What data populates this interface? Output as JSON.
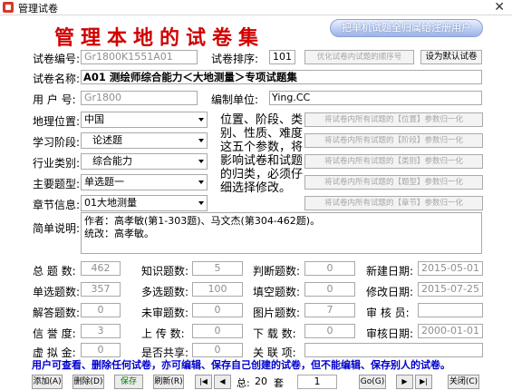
{
  "window": {
    "title": "管理试卷",
    "close_glyph": "✕"
  },
  "heading": "管理本地的试卷集",
  "assign_button": "把单机试题全归属给注册用户",
  "paper_no": {
    "label": "试卷编号:",
    "value": "Gr1800K1551A01"
  },
  "order": {
    "label": "试卷排序:",
    "value": "101"
  },
  "optimize_button": "优化试卷内试题的顺序号",
  "default_button": "设为默认试卷",
  "paper_name": {
    "label": "试卷名称:",
    "value": "A01 测绘师综合能力＜大地测量＞专项试题集"
  },
  "user_no": {
    "label": "用 户 号:",
    "value": "Gr1800"
  },
  "unit": {
    "label": "编制单位:",
    "value": "Ying.CC"
  },
  "location": {
    "label": "地理位置:",
    "value": "中国"
  },
  "stage": {
    "label": "学习阶段:",
    "value": "论述题"
  },
  "industry": {
    "label": "行业类别:",
    "value": "综合能力"
  },
  "main_type": {
    "label": "主要题型:",
    "value": "单选题一"
  },
  "chapter": {
    "label": "章节信息:",
    "value": "01大地测量"
  },
  "note": "位置、阶段、类别、性质、难度这五个参数，将影响试卷和试题的归类，必须仔细选择修改。",
  "normalize_buttons": [
    "将试卷内所有试题的【位置】参数归一化",
    "将试卷内所有试题的【阶段】参数归一化",
    "将试卷内所有试题的【类别】参数归一化",
    "将试卷内所有试题的【题型】参数归一化",
    "将试卷内所有试题的【章节】参数归一化"
  ],
  "desc": {
    "label": "简单说明:",
    "line1": "作者：高孝敏(第1-303题)、马文杰(第304-462题)。",
    "line2": "统改：高孝敏。"
  },
  "stats": {
    "total": {
      "label": "总 题 数:",
      "value": "462"
    },
    "knowledge": {
      "label": "知识题数:",
      "value": "5"
    },
    "judge": {
      "label": "判断题数:",
      "value": "0"
    },
    "created": {
      "label": "新建日期:",
      "value": "2015-05-01"
    },
    "single": {
      "label": "单选题数:",
      "value": "357"
    },
    "multi": {
      "label": "多选题数:",
      "value": "100"
    },
    "fill": {
      "label": "填空题数:",
      "value": "0"
    },
    "modified": {
      "label": "修改日期:",
      "value": "2015-07-25"
    },
    "answer": {
      "label": "解答题数:",
      "value": "0"
    },
    "unaudited": {
      "label": "未审题数:",
      "value": "0"
    },
    "image": {
      "label": "图片题数:",
      "value": "7"
    },
    "auditor": {
      "label": "审 核 员:",
      "value": ""
    },
    "credit": {
      "label": "信 誉 度:",
      "value": "3"
    },
    "upload": {
      "label": "上 传 数:",
      "value": "0"
    },
    "download": {
      "label": "下 载 数:",
      "value": "0"
    },
    "audit_date": {
      "label": "审核日期:",
      "value": "2000-01-01"
    },
    "virtual": {
      "label": "虚 拟 金:",
      "value": "0"
    },
    "shared": {
      "label": "是否共享:",
      "value": "0"
    },
    "related": {
      "label": "关 联 项:",
      "value": ""
    }
  },
  "info": "用户可查看、删除任何试卷，亦可编辑、保存自己创建的试卷，但不能编辑、保存别人的试卷。",
  "toolbar": {
    "add": "添加(A)",
    "delete": "删除(D)",
    "save": "保存(S)",
    "refresh": "刷新(R)",
    "first": "|◀",
    "prev": "◀",
    "total_label": "总:",
    "total_value": "20",
    "unit": "套",
    "page": "1",
    "go": "Go(G)",
    "next": "▶",
    "last": "▶|",
    "close": "关闭(C)"
  }
}
